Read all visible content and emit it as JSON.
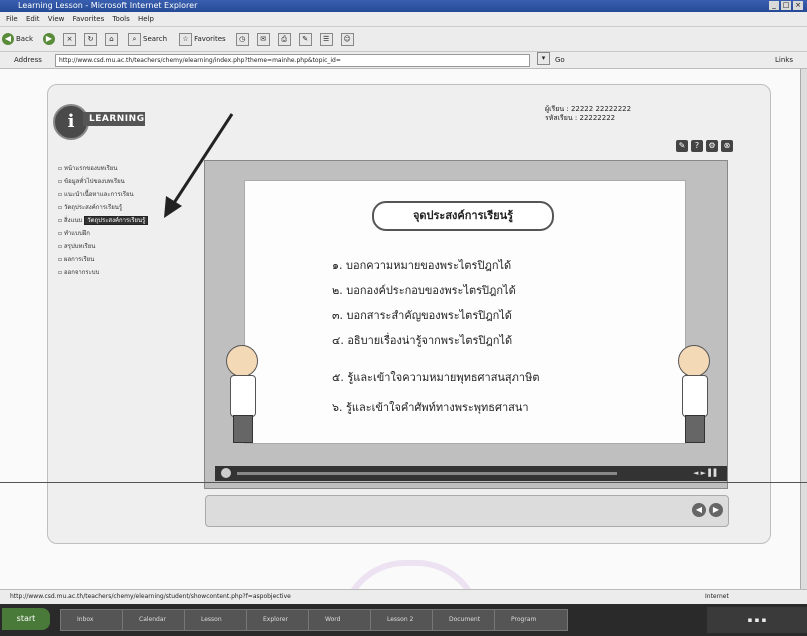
{
  "window": {
    "title": "Learning Lesson - Microsoft Internet Explorer"
  },
  "menu": [
    "File",
    "Edit",
    "View",
    "Favorites",
    "Tools",
    "Help"
  ],
  "toolbar": {
    "back_label": "Back",
    "search_label": "Search",
    "favorites_label": "Favorites"
  },
  "address": {
    "label": "Address",
    "url": "http://www.csd.mu.ac.th/teachers/chemy/elearning/index.php?theme=mainhe.php&topic_id=",
    "go_label": "Go",
    "links_label": "Links"
  },
  "header": {
    "logo_letter": "i",
    "logo_text": "LEARNING",
    "user_line1": "ผู้เรียน : 22222 22222222",
    "user_line2": "รหัสเรียน : 22222222"
  },
  "sidebar": {
    "items": [
      {
        "label": "หน้าแรกของบทเรียน",
        "selected": false
      },
      {
        "label": "ข้อมูลทั่วไปของบทเรียน",
        "selected": false
      },
      {
        "label": "แนะนำเนื้อหาและการเรียน",
        "selected": false
      },
      {
        "label": "วัตถุประสงค์การเรียนรู้",
        "selected": false
      },
      {
        "label": "สิ่งแนบ",
        "selected": true,
        "badge": "วัตถุประสงค์การเรียนรู้"
      },
      {
        "label": "ทำแบบฝึก",
        "selected": false
      },
      {
        "label": "สรุปบทเรียน",
        "selected": false
      },
      {
        "label": "ผลการเรียน",
        "selected": false
      },
      {
        "label": "ออกจากระบบ",
        "selected": false
      }
    ]
  },
  "lesson": {
    "heading": "จุดประสงค์การเรียนรู้",
    "objectives": [
      "๑. บอกความหมายของพระไตรปิฎกได้",
      "๒. บอกองค์ประกอบของพระไตรปิฎกได้",
      "๓. บอกสาระสำคัญของพระไตรปิฎกได้",
      "๔. อธิบายเรื่องน่ารู้จากพระไตรปิฎกได้",
      "๕. รู้และเข้าใจความหมายพุทธศาสนสุภาษิต",
      "๖. รู้และเข้าใจคำศัพท์ทางพระพุทธศาสนา"
    ]
  },
  "statusbar": {
    "url": "http://www.csd.mu.ac.th/teachers/chemy/elearning/student/showcontent.php?f=aspobjective",
    "zone": "Internet"
  },
  "taskbar": {
    "start_label": "start",
    "tasks": [
      "Inbox",
      "Calendar",
      "Lesson",
      "Explorer",
      "Word",
      "Lesson 2",
      "Document",
      "Program"
    ]
  },
  "colors": {
    "title_bar": "#2f55a4",
    "taskbar": "#2a2a2a"
  }
}
